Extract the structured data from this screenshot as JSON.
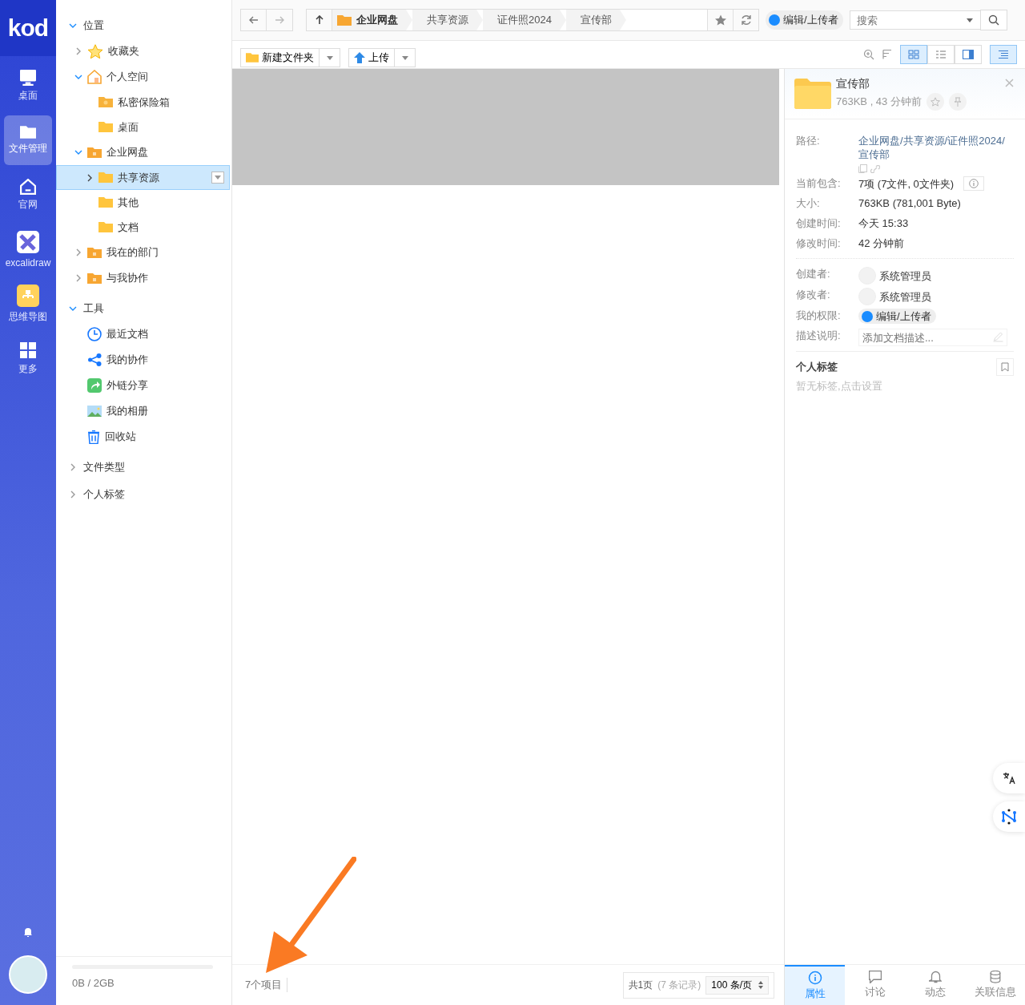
{
  "rail": {
    "logo": "kod",
    "items": [
      {
        "kind": "desktop",
        "label": "桌面",
        "selected": false
      },
      {
        "kind": "folder",
        "label": "文件管理",
        "selected": true
      },
      {
        "kind": "home",
        "label": "官网",
        "selected": false
      },
      {
        "kind": "excalidraw",
        "label": "excalidraw",
        "selected": false
      },
      {
        "kind": "mindmap",
        "label": "思维导图",
        "selected": false
      },
      {
        "kind": "grid",
        "label": "更多",
        "selected": false
      }
    ]
  },
  "tree": {
    "sections": [
      {
        "label": "位置",
        "expanded": true,
        "children": [
          {
            "kind": "star",
            "label": "收藏夹",
            "expanded": false,
            "selected": false
          },
          {
            "kind": "home",
            "label": "个人空间",
            "expanded": true,
            "selected": false,
            "children": [
              {
                "kind": "safe",
                "label": "私密保险箱",
                "selected": false
              },
              {
                "kind": "folder",
                "label": "桌面",
                "selected": false
              }
            ]
          },
          {
            "kind": "enterprise",
            "label": "企业网盘",
            "expanded": true,
            "selected": false,
            "children": [
              {
                "kind": "folder",
                "label": "共享资源",
                "expanded": false,
                "selected": true
              },
              {
                "kind": "folder",
                "label": "其他",
                "selected": false
              },
              {
                "kind": "folder",
                "label": "文档",
                "selected": false
              }
            ]
          },
          {
            "kind": "dept",
            "label": "我在的部门",
            "expanded": false,
            "selected": false
          },
          {
            "kind": "share",
            "label": "与我协作",
            "expanded": false,
            "selected": false
          }
        ]
      },
      {
        "label": "工具",
        "expanded": true,
        "children": [
          {
            "kind": "clock",
            "label": "最近文档",
            "selected": false
          },
          {
            "kind": "collab",
            "label": "我的协作",
            "selected": false
          },
          {
            "kind": "link",
            "label": "外链分享",
            "selected": false
          },
          {
            "kind": "photo",
            "label": "我的相册",
            "selected": false
          },
          {
            "kind": "trash",
            "label": "回收站",
            "selected": false
          }
        ]
      },
      {
        "label": "文件类型",
        "expanded": false
      },
      {
        "label": "个人标签",
        "expanded": false
      }
    ]
  },
  "storage": {
    "text": "0B / 2GB"
  },
  "toolbar": {
    "breadcrumb": [
      "企业网盘",
      "共享资源",
      "证件照2024",
      "宣传部"
    ],
    "permission": "编辑/上传者",
    "search_placeholder": "搜索"
  },
  "actions": [
    "新建文件夹",
    "上传"
  ],
  "views": [
    {
      "kind": "icons",
      "selected": true
    },
    {
      "kind": "list",
      "selected": false
    },
    {
      "kind": "split",
      "selected": false
    }
  ],
  "details_toggle": {
    "selected": true
  },
  "status": {
    "count": "7个项目",
    "pages": "共1页",
    "records": "(7 条记录)",
    "per_page": "100 条/页"
  },
  "details": {
    "name": "宣传部",
    "meta": "763KB , 43 分钟前",
    "props": [
      {
        "kind": "path",
        "label": "路径:",
        "value": "企业网盘/共享资源/证件照2024/宣传部"
      },
      {
        "kind": "info",
        "label": "当前包含:",
        "value": "7项 (7文件, 0文件夹)"
      },
      {
        "kind": "text",
        "label": "大小:",
        "value": "763KB (781,001 Byte)"
      },
      {
        "kind": "text",
        "label": "创建时间:",
        "value": "今天 15:33"
      },
      {
        "kind": "text",
        "label": "修改时间:",
        "value": "42 分钟前"
      },
      {
        "kind": "user",
        "label": "创建者:",
        "value": "系统管理员"
      },
      {
        "kind": "user",
        "label": "修改者:",
        "value": "系统管理员"
      },
      {
        "kind": "permission",
        "label": "我的权限:",
        "value": "编辑/上传者"
      },
      {
        "kind": "input",
        "label": "描述说明:",
        "placeholder": "添加文档描述..."
      }
    ],
    "tags_title": "个人标签",
    "tags_empty": "暂无标签,点击设置",
    "tabs": [
      {
        "kind": "info",
        "label": "属性",
        "selected": true
      },
      {
        "kind": "chat",
        "label": "讨论",
        "selected": false
      },
      {
        "kind": "bell",
        "label": "动态",
        "selected": false
      },
      {
        "kind": "db",
        "label": "关联信息",
        "selected": false
      }
    ]
  }
}
